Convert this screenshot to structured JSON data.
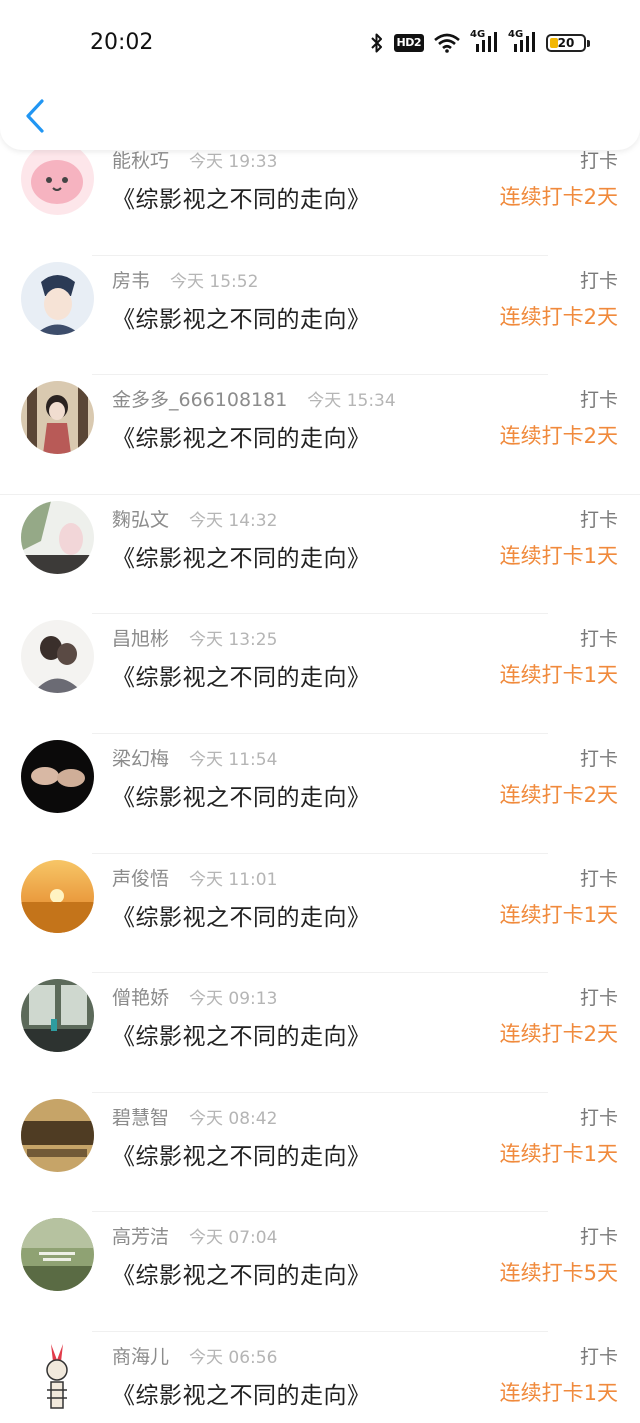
{
  "status_bar": {
    "time": "20:02",
    "hd_label": "HD2",
    "network_label_1": "4G",
    "network_label_2": "4G",
    "battery_level": "20"
  },
  "icons": {
    "back": "chevron-left-icon",
    "bluetooth": "bluetooth-icon",
    "wifi": "wifi-icon"
  },
  "colors": {
    "accent_back": "#2196f3",
    "streak_text": "#f08a3c",
    "battery_fill": "#f2b705"
  },
  "entries": [
    {
      "name": "能秋巧",
      "time": "今天 19:33",
      "book": "《综影视之不同的走向》",
      "action": "打卡",
      "streak": "连续打卡2天"
    },
    {
      "name": "房韦",
      "time": "今天 15:52",
      "book": "《综影视之不同的走向》",
      "action": "打卡",
      "streak": "连续打卡2天"
    },
    {
      "name": "金多多_666108181",
      "time": "今天 15:34",
      "book": "《综影视之不同的走向》",
      "action": "打卡",
      "streak": "连续打卡2天"
    },
    {
      "name": "麴弘文",
      "time": "今天 14:32",
      "book": "《综影视之不同的走向》",
      "action": "打卡",
      "streak": "连续打卡1天"
    },
    {
      "name": "昌旭彬",
      "time": "今天 13:25",
      "book": "《综影视之不同的走向》",
      "action": "打卡",
      "streak": "连续打卡1天"
    },
    {
      "name": "梁幻梅",
      "time": "今天 11:54",
      "book": "《综影视之不同的走向》",
      "action": "打卡",
      "streak": "连续打卡2天"
    },
    {
      "name": "声俊悟",
      "time": "今天 11:01",
      "book": "《综影视之不同的走向》",
      "action": "打卡",
      "streak": "连续打卡1天"
    },
    {
      "name": "僧艳娇",
      "time": "今天 09:13",
      "book": "《综影视之不同的走向》",
      "action": "打卡",
      "streak": "连续打卡2天"
    },
    {
      "name": "碧慧智",
      "time": "今天 08:42",
      "book": "《综影视之不同的走向》",
      "action": "打卡",
      "streak": "连续打卡1天"
    },
    {
      "name": "高芳洁",
      "time": "今天 07:04",
      "book": "《综影视之不同的走向》",
      "action": "打卡",
      "streak": "连续打卡5天"
    },
    {
      "name": "商海儿",
      "time": "今天 06:56",
      "book": "《综影视之不同的走向》",
      "action": "打卡",
      "streak": "连续打卡1天"
    }
  ]
}
